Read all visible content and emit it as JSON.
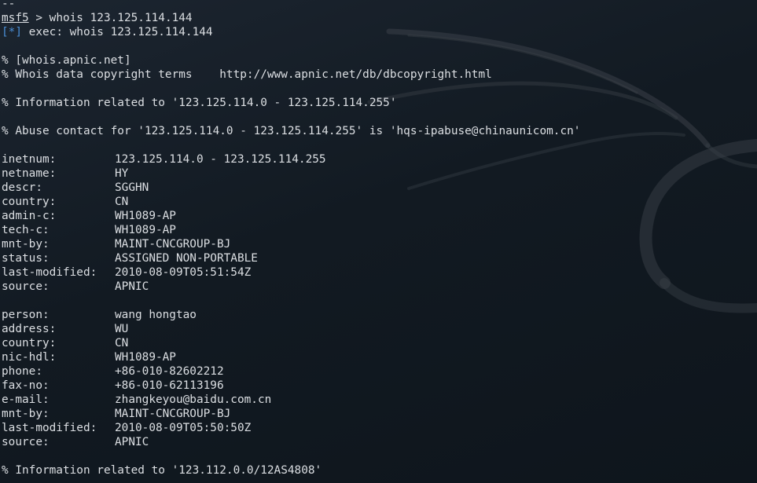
{
  "terminal": {
    "top_fragment": "--",
    "prompt": {
      "name": "msf5",
      "separator": " > ",
      "command": "whois 123.125.114.144"
    },
    "exec_line": {
      "marker": "[*]",
      "text": " exec: whois 123.125.114.144"
    },
    "header_lines": [
      "% [whois.apnic.net]",
      "% Whois data copyright terms    http://www.apnic.net/db/dbcopyright.html"
    ],
    "info_line_1": "% Information related to '123.125.114.0 - 123.125.114.255'",
    "abuse_line": "% Abuse contact for '123.125.114.0 - 123.125.114.255' is 'hqs-ipabuse@chinaunicom.cn'",
    "inetnum_block": [
      {
        "key": "inetnum:",
        "value": "123.125.114.0 - 123.125.114.255"
      },
      {
        "key": "netname:",
        "value": "HY"
      },
      {
        "key": "descr:",
        "value": "SGGHN"
      },
      {
        "key": "country:",
        "value": "CN"
      },
      {
        "key": "admin-c:",
        "value": "WH1089-AP"
      },
      {
        "key": "tech-c:",
        "value": "WH1089-AP"
      },
      {
        "key": "mnt-by:",
        "value": "MAINT-CNCGROUP-BJ"
      },
      {
        "key": "status:",
        "value": "ASSIGNED NON-PORTABLE"
      },
      {
        "key": "last-modified:",
        "value": "2010-08-09T05:51:54Z"
      },
      {
        "key": "source:",
        "value": "APNIC"
      }
    ],
    "person_block": [
      {
        "key": "person:",
        "value": "wang hongtao"
      },
      {
        "key": "address:",
        "value": "WU"
      },
      {
        "key": "country:",
        "value": "CN"
      },
      {
        "key": "nic-hdl:",
        "value": "WH1089-AP"
      },
      {
        "key": "phone:",
        "value": "+86-010-82602212"
      },
      {
        "key": "fax-no:",
        "value": "+86-010-62113196"
      },
      {
        "key": "e-mail:",
        "value": "zhangkeyou@baidu.com.cn"
      },
      {
        "key": "mnt-by:",
        "value": "MAINT-CNCGROUP-BJ"
      },
      {
        "key": "last-modified:",
        "value": "2010-08-09T05:50:50Z"
      },
      {
        "key": "source:",
        "value": "APNIC"
      }
    ],
    "info_line_2": "% Information related to '123.112.0.0/12AS4808'"
  },
  "colors": {
    "text": "#dcdfe3",
    "marker": "#4a8fd6",
    "background": "#141c24"
  }
}
